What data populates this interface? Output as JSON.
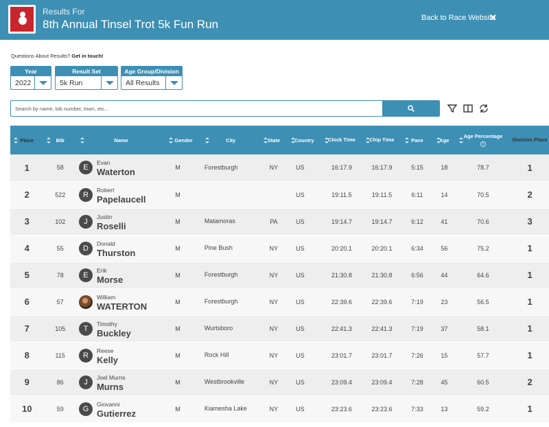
{
  "header": {
    "results_for": "Results For",
    "race_title": "8th Annual Tinsel Trot 5k Fun Run",
    "back_link": "Back to Race Website",
    "logo_icon": "snowman-logo-icon",
    "close_icon": "close-icon",
    "bar_color": "#3e8fb4"
  },
  "questions": {
    "text": "Questions About Results?",
    "link": "Get in touch!"
  },
  "filters": {
    "year": {
      "label": "Year",
      "value": "2022"
    },
    "result_set": {
      "label": "Result Set",
      "value": "5k Run"
    },
    "age_group": {
      "label": "Age Group/Division",
      "value": "All Results"
    }
  },
  "search": {
    "placeholder": "Search by name, bib number, town, etc..."
  },
  "toolbar_icons": [
    "filter-icon",
    "columns-icon",
    "refresh-icon"
  ],
  "columns": {
    "place": "Place",
    "bib": "Bib",
    "name": "Name",
    "gender": "Gender",
    "city": "City",
    "state": "State",
    "country": "Country",
    "clock_time": "Clock Time",
    "chip_time": "Chip Time",
    "pace": "Pace",
    "age": "Age",
    "age_percentage": "Age Percentage",
    "division_place": "Division Place"
  },
  "rows": [
    {
      "place": "1",
      "bib": "58",
      "initial": "E",
      "first": "Evan",
      "last": "Waterton",
      "gender": "M",
      "city": "Forestburgh",
      "state": "NY",
      "country": "US",
      "clock": "16:17.9",
      "chip": "16:17.9",
      "pace": "5:15",
      "age": "18",
      "pct": "78.7",
      "div": "1"
    },
    {
      "place": "2",
      "bib": "522",
      "initial": "R",
      "first": "Robert",
      "last": "Papelaucell",
      "gender": "M",
      "city": "",
      "state": "",
      "country": "US",
      "clock": "19:11.5",
      "chip": "19:11.5",
      "pace": "6:11",
      "age": "14",
      "pct": "70.5",
      "div": "2"
    },
    {
      "place": "3",
      "bib": "102",
      "initial": "J",
      "first": "Justin",
      "last": "Roselli",
      "gender": "M",
      "city": "Matamoras",
      "state": "PA",
      "country": "US",
      "clock": "19:14.7",
      "chip": "19:14.7",
      "pace": "6:12",
      "age": "41",
      "pct": "70.6",
      "div": "3"
    },
    {
      "place": "4",
      "bib": "55",
      "initial": "D",
      "first": "Donald",
      "last": "Thurston",
      "gender": "M",
      "city": "Pine Bush",
      "state": "NY",
      "country": "US",
      "clock": "20:20.1",
      "chip": "20:20.1",
      "pace": "6:34",
      "age": "56",
      "pct": "75.2",
      "div": "1"
    },
    {
      "place": "5",
      "bib": "78",
      "initial": "E",
      "first": "Erik",
      "last": "Morse",
      "gender": "M",
      "city": "Forestburgh",
      "state": "NY",
      "country": "US",
      "clock": "21:30.8",
      "chip": "21:30.8",
      "pace": "6:56",
      "age": "44",
      "pct": "64.6",
      "div": "1"
    },
    {
      "place": "6",
      "bib": "57",
      "initial": "",
      "first": "William",
      "last": "WATERTON",
      "gender": "M",
      "city": "Forestburgh",
      "state": "NY",
      "country": "US",
      "clock": "22:39.6",
      "chip": "22:39.6",
      "pace": "7:19",
      "age": "23",
      "pct": "56.5",
      "div": "1"
    },
    {
      "place": "7",
      "bib": "105",
      "initial": "T",
      "first": "Timothy",
      "last": "Buckley",
      "gender": "M",
      "city": "Wurtsboro",
      "state": "NY",
      "country": "US",
      "clock": "22:41.3",
      "chip": "22:41.3",
      "pace": "7:19",
      "age": "37",
      "pct": "58.1",
      "div": "1"
    },
    {
      "place": "8",
      "bib": "115",
      "initial": "R",
      "first": "Reese",
      "last": "Kelly",
      "gender": "M",
      "city": "Rock Hill",
      "state": "NY",
      "country": "US",
      "clock": "23:01.7",
      "chip": "23:01.7",
      "pace": "7:26",
      "age": "15",
      "pct": "57.7",
      "div": "1"
    },
    {
      "place": "9",
      "bib": "86",
      "initial": "J",
      "first": "Joel Murns",
      "last": "Murns",
      "gender": "M",
      "city": "Westbrookville",
      "state": "NY",
      "country": "US",
      "clock": "23:09.4",
      "chip": "23:09.4",
      "pace": "7:28",
      "age": "45",
      "pct": "60.5",
      "div": "2"
    },
    {
      "place": "10",
      "bib": "59",
      "initial": "G",
      "first": "Giovanni",
      "last": "Gutierrez",
      "gender": "M",
      "city": "Kiamesha Lake",
      "state": "NY",
      "country": "US",
      "clock": "23:23.6",
      "chip": "23:23.6",
      "pace": "7:33",
      "age": "13",
      "pct": "59.2",
      "div": "1"
    }
  ]
}
